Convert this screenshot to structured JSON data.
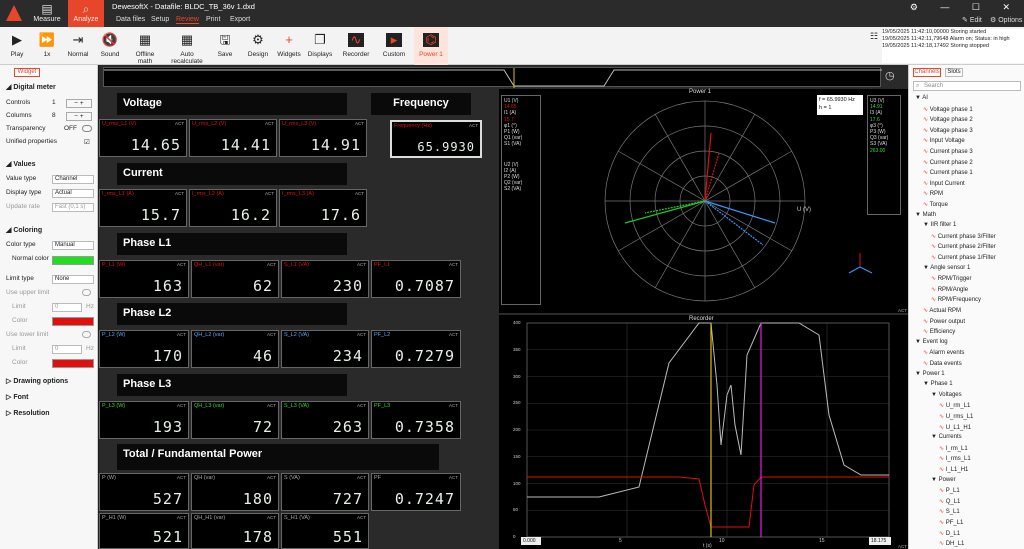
{
  "app": {
    "title": "DewesoftX - Datafile: BLDC_TB_36v 1.dxd",
    "measure": "Measure",
    "analyze": "Analyze",
    "edit": "Edit",
    "options": "Options"
  },
  "menu": [
    "Data files",
    "Setup",
    "Review",
    "Print",
    "Export"
  ],
  "toolbar": [
    "Play",
    "1x",
    "Normal",
    "Sound",
    "Offline math",
    "Auto recalculate",
    "Save",
    "Design",
    "Widgets",
    "Displays",
    "Recorder",
    "Custom",
    "Power 1"
  ],
  "log": [
    "19/05/2025 11:42:10,00000 Storing started",
    "19/05/2025 11:42:11,79648 Alarm on; Status: in high",
    "19/05/2025 11:42:18,17492 Storing stopped"
  ],
  "left": {
    "tab": "Widget",
    "digital_meter": "Digital meter",
    "controls": "Controls",
    "controls_val": "1",
    "columns": "Columns",
    "columns_val": "8",
    "transparency": "Transparency",
    "transparency_val": "OFF",
    "unified": "Unified properties",
    "values": "Values",
    "value_type": "Value type",
    "value_type_val": "Channel",
    "display_type": "Display type",
    "display_type_val": "Actual",
    "update_rate": "Update rate",
    "update_rate_val": "Fast (0,1 s)",
    "coloring": "Coloring",
    "color_type": "Color type",
    "color_type_val": "Manual",
    "normal_color": "Normal color",
    "limit_type": "Limit type",
    "limit_type_val": "None",
    "use_upper": "Use upper limit",
    "limit": "Limit",
    "limit_val": "0",
    "hz": "Hz",
    "color": "Color",
    "use_lower": "Use lower limit",
    "drawing": "Drawing options",
    "font": "Font",
    "resolution": "Resolution"
  },
  "headers": {
    "voltage": "Voltage",
    "frequency": "Frequency",
    "current": "Current",
    "l1": "Phase L1",
    "l2": "Phase L2",
    "l3": "Phase L3",
    "total": "Total / Fundamental Power"
  },
  "meters": {
    "v1": {
      "label": "U_rms_L1 (V)",
      "value": "14.65"
    },
    "v2": {
      "label": "U_rms_L2 (V)",
      "value": "14.41"
    },
    "v3": {
      "label": "U_rms_L3 (V)",
      "value": "14.91"
    },
    "f": {
      "label": "Frequency (Hz)",
      "value": "65.9930"
    },
    "i1": {
      "label": "I_rms_L1 (A)",
      "value": "15.7"
    },
    "i2": {
      "label": "I_rms_L2 (A)",
      "value": "16.2"
    },
    "i3": {
      "label": "I_rms_L3 (A)",
      "value": "17.6"
    },
    "p1": {
      "label": "P_L1 (W)",
      "value": "163"
    },
    "q1": {
      "label": "QH_L1 (var)",
      "value": "62"
    },
    "s1": {
      "label": "S_L1 (VA)",
      "value": "230"
    },
    "pf1": {
      "label": "PF_L1",
      "value": "0.7087"
    },
    "p2": {
      "label": "P_L2 (W)",
      "value": "170"
    },
    "q2": {
      "label": "QH_L2 (var)",
      "value": "46"
    },
    "s2": {
      "label": "S_L2 (VA)",
      "value": "234"
    },
    "pf2": {
      "label": "PF_L2",
      "value": "0.7279"
    },
    "p3": {
      "label": "P_L3 (W)",
      "value": "193"
    },
    "q3": {
      "label": "QH_L3 (var)",
      "value": "72"
    },
    "s3": {
      "label": "S_L3 (VA)",
      "value": "263"
    },
    "pf3": {
      "label": "PF_L3",
      "value": "0.7358"
    },
    "pt": {
      "label": "P (W)",
      "value": "527"
    },
    "qt": {
      "label": "QH (var)",
      "value": "180"
    },
    "st": {
      "label": "S (VA)",
      "value": "727"
    },
    "pft": {
      "label": "PF",
      "value": "0.7247"
    },
    "ph": {
      "label": "P_H1 (W)",
      "value": "521"
    },
    "qh": {
      "label": "QH_H1 (var)",
      "value": "178"
    },
    "sh": {
      "label": "S_H1 (VA)",
      "value": "551"
    }
  },
  "act": "ACT",
  "vector": {
    "title": "Power 1",
    "freq": "f = 65.9930 Hz",
    "h": "h = 1",
    "u_axis": "U (V)",
    "left_vals": [
      "U1 (V)",
      "14.65",
      "I1 (A)",
      "15.7",
      "φ1 (°)",
      "P1 (W)",
      "Q1 (var)",
      "S1 (VA)",
      "U2 (V)",
      "I2 (A)",
      "P2 (W)",
      "Q2 (var)",
      "S2 (VA)"
    ],
    "right_vals": [
      "U3 (V)",
      "14.91",
      "I3 (A)",
      "17.6",
      "φ3 (°)",
      "P3 (W)",
      "Q3 (var)",
      "S3 (VA)",
      "263.00"
    ]
  },
  "recorder": {
    "title": "Recorder",
    "x_label": "t (s)",
    "ticks_x": [
      "0.000",
      "5",
      "10",
      "15",
      "18.175"
    ],
    "ticks_y": [
      "400",
      "350",
      "300",
      "250",
      "200",
      "150",
      "100",
      "50",
      "0"
    ]
  },
  "tabs": {
    "channels": "Channels",
    "slots": "Slots",
    "search": "Search"
  },
  "tree": [
    [
      "▼ AI",
      0
    ],
    [
      "Voltage phase 1",
      1
    ],
    [
      "Voltage phase 2",
      1
    ],
    [
      "Voltage phase 3",
      1
    ],
    [
      "Input Voltage",
      1
    ],
    [
      "Current phase 3",
      1
    ],
    [
      "Current phase 2",
      1
    ],
    [
      "Current phase 1",
      1
    ],
    [
      "Input Current",
      1
    ],
    [
      "RPM",
      1
    ],
    [
      "Torque",
      1
    ],
    [
      "▼ Math",
      0
    ],
    [
      "▼ IIR filter 1",
      1
    ],
    [
      "Current phase 3/Filter",
      2
    ],
    [
      "Current phase 2/Filter",
      2
    ],
    [
      "Current phase 1/Filter",
      2
    ],
    [
      "▼ Angle sensor 1",
      1
    ],
    [
      "RPM/Trigger",
      2
    ],
    [
      "RPM/Angle",
      2
    ],
    [
      "RPM/Frequency",
      2
    ],
    [
      "Actual RPM",
      1
    ],
    [
      "Power output",
      1
    ],
    [
      "Efficiency",
      1
    ],
    [
      "▼ Event log",
      0
    ],
    [
      "Alarm events",
      1
    ],
    [
      "Data events",
      1
    ],
    [
      "▼ Power 1",
      0
    ],
    [
      "▼ Phase 1",
      1
    ],
    [
      "▼ Voltages",
      2
    ],
    [
      "U_rm_L1",
      3
    ],
    [
      "U_rms_L1",
      3
    ],
    [
      "U_L1_H1",
      3
    ],
    [
      "▼ Currents",
      2
    ],
    [
      "I_rm_L1",
      3
    ],
    [
      "I_rms_L1",
      3
    ],
    [
      "I_L1_H1",
      3
    ],
    [
      "▼ Power",
      2
    ],
    [
      "P_L1",
      3
    ],
    [
      "Q_L1",
      3
    ],
    [
      "S_L1",
      3
    ],
    [
      "PF_L1",
      3
    ],
    [
      "D_L1",
      3
    ],
    [
      "DH_L1",
      3
    ]
  ],
  "colors": {
    "accent": "#e8462a",
    "meter_red": "#e01010",
    "green": "#22dd22"
  }
}
